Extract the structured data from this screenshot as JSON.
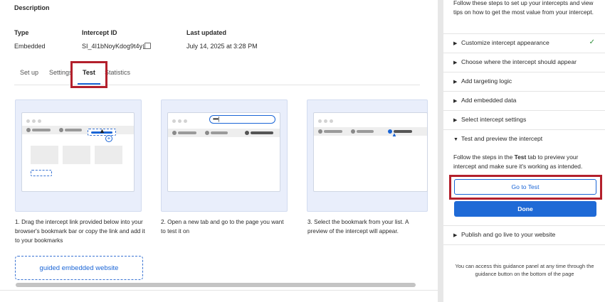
{
  "main": {
    "description_title": "Description",
    "meta": {
      "type_label": "Type",
      "type_value": "Embedded",
      "id_label": "Intercept ID",
      "id_value": "SI_4I1bNoyKdog9t4y",
      "updated_label": "Last updated",
      "updated_value": "July 14, 2025 at 3:28 PM"
    },
    "tabs": [
      {
        "label": "Set up"
      },
      {
        "label": "Settings"
      },
      {
        "label": "Test",
        "active": true
      },
      {
        "label": "Statistics"
      }
    ],
    "steps": [
      {
        "text": "1. Drag the intercept link provided below into your browser's bookmark bar or copy the link and add it to your bookmarks"
      },
      {
        "text": "2. Open a new tab and go to the page you want to test it on"
      },
      {
        "text": "3. Select the bookmark from your list. A preview of the intercept will appear."
      }
    ],
    "illustration_url_text": "••••|",
    "bookmark_link_label": "guided embedded website"
  },
  "panel": {
    "intro": "Follow these steps to set up your intercepts and view tips on how to get the most value from your intercept.",
    "steps": [
      {
        "label": "Customize intercept appearance",
        "completed": true
      },
      {
        "label": "Choose where the intercept should appear"
      },
      {
        "label": "Add targeting logic"
      },
      {
        "label": "Add embedded data"
      },
      {
        "label": "Select intercept settings"
      },
      {
        "label": "Test and preview the intercept",
        "expanded": true
      },
      {
        "label": "Publish and go live to your website"
      }
    ],
    "expanded_text_before": "Follow the steps in the ",
    "expanded_text_bold": "Test",
    "expanded_text_after": " tab to preview your intercept and make sure it's working as intended.",
    "go_to_test_label": "Go to Test",
    "done_label": "Done",
    "footer_note": "You can access this guidance panel at any time through the guidance button on the bottom of the page"
  },
  "colors": {
    "accent": "#1a65d6",
    "highlight": "#b3202c",
    "check": "#2f8f3a",
    "card_bg": "#e9eefb"
  },
  "icons": {
    "copy": "copy-icon",
    "chevron_right": "chevron-right-icon",
    "chevron_down": "chevron-down-icon",
    "check": "check-icon",
    "cursor": "cursor-icon"
  }
}
